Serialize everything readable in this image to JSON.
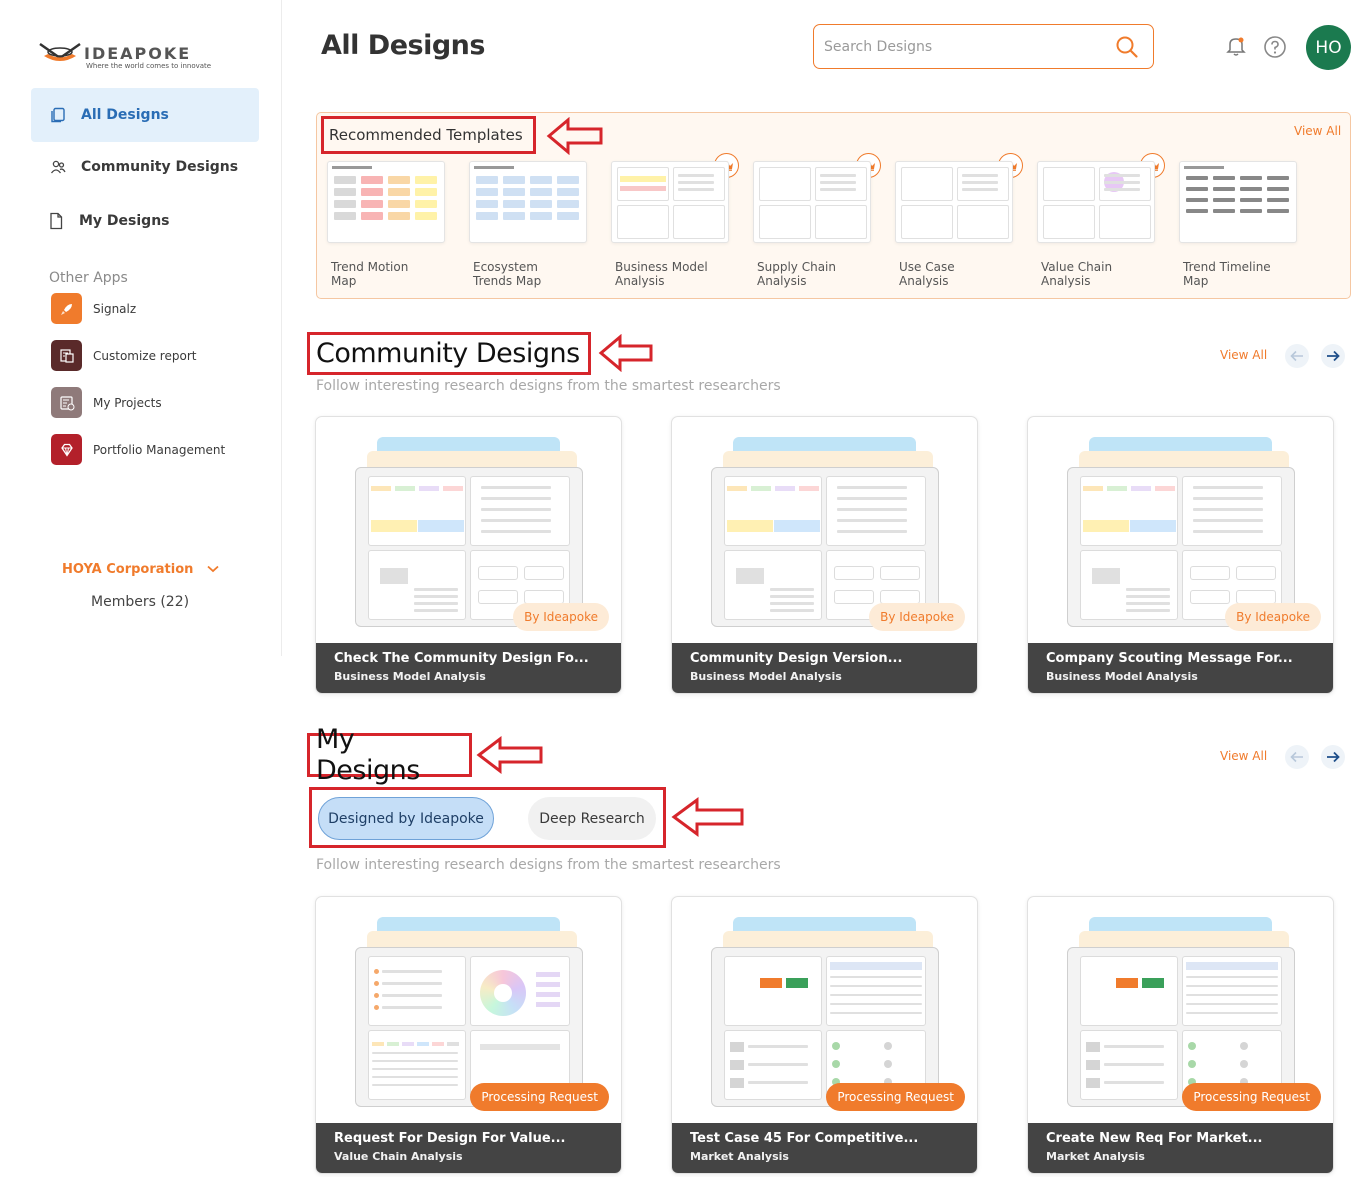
{
  "app": {
    "logo_text": "IDEAPOKE",
    "logo_tagline": "Where the world comes to innovate",
    "page_title": "All Designs"
  },
  "sidebar": {
    "nav": [
      {
        "label": "All Designs",
        "icon": "copy-icon",
        "active": true
      },
      {
        "label": "Community Designs",
        "icon": "users-icon",
        "active": false
      },
      {
        "label": "My Designs",
        "icon": "file-icon",
        "active": false
      }
    ],
    "other_apps_label": "Other Apps",
    "apps": [
      {
        "label": "Signalz",
        "icon": "rocket-icon",
        "color": "#f07b2c"
      },
      {
        "label": "Customize report",
        "icon": "report-icon",
        "color": "#5a2a2a"
      },
      {
        "label": "My Projects",
        "icon": "projects-icon",
        "color": "#8f7a7a"
      },
      {
        "label": "Portfolio Management",
        "icon": "diamond-icon",
        "color": "#b3202a"
      }
    ],
    "org_name": "HOYA Corporation",
    "members": "Members (22)"
  },
  "header": {
    "search_placeholder": "Search Designs",
    "avatar_initials": "HO"
  },
  "recommended": {
    "title": "Recommended Templates",
    "view_all": "View All",
    "templates": [
      {
        "label": "Trend Motion Map",
        "premium": false
      },
      {
        "label": "Ecosystem Trends Map",
        "premium": false
      },
      {
        "label": "Business Model Analysis",
        "premium": true
      },
      {
        "label": "Supply Chain Analysis",
        "premium": true
      },
      {
        "label": "Use Case Analysis",
        "premium": true
      },
      {
        "label": "Value Chain Analysis",
        "premium": true
      },
      {
        "label": "Trend Timeline Map",
        "premium": false
      }
    ]
  },
  "community": {
    "title": "Community Designs",
    "subtitle": "Follow interesting research designs from the smartest researchers",
    "view_all": "View All",
    "cards": [
      {
        "title": "Check The Community Design Fo...",
        "subtitle": "Business Model Analysis",
        "badge": "By Ideapoke"
      },
      {
        "title": "Community Design Version...",
        "subtitle": "Business Model Analysis",
        "badge": "By Ideapoke"
      },
      {
        "title": "Company Scouting Message For...",
        "subtitle": "Business Model Analysis",
        "badge": "By Ideapoke"
      }
    ]
  },
  "my_designs": {
    "title": "My Designs",
    "subtitle": "Follow interesting research designs from the smartest researchers",
    "view_all": "View All",
    "tabs": [
      "Designed by Ideapoke",
      "Deep Research"
    ],
    "cards": [
      {
        "title": "Request For Design For Value...",
        "subtitle": "Value Chain Analysis",
        "badge": "Processing Request"
      },
      {
        "title": "Test Case 45 For Competitive...",
        "subtitle": "Market Analysis",
        "badge": "Processing Request"
      },
      {
        "title": "Create New Req For Market...",
        "subtitle": "Market Analysis",
        "badge": "Processing Request"
      }
    ]
  },
  "colors": {
    "accent": "#f07b2c",
    "active_nav_bg": "#e3f0fb",
    "avatar": "#1b7a4f",
    "annotation_red": "#d6252b"
  }
}
